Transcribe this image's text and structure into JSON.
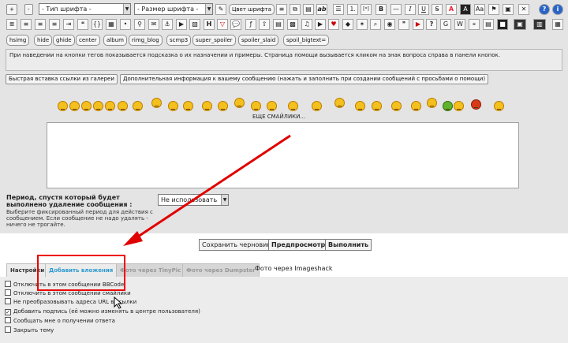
{
  "toolbar1": {
    "plus": "+",
    "minus": "-",
    "font_type": "- Тип шрифта -",
    "font_size": "- Размер шрифта -",
    "font_color_button": "Цвет шрифта",
    "glyph_labels": [
      "ab",
      "[*]",
      "B",
      "I",
      "U",
      "A",
      "A",
      "?"
    ]
  },
  "toolbar2": {
    "glyph_labels": [
      "H",
      "?"
    ]
  },
  "tag_buttons": [
    "hsimg",
    "hide",
    "ghide",
    "center",
    "album",
    "rimg_blog",
    "scmp3",
    "super_spoiler",
    "spoiler_slaid",
    "spoil_bigtext="
  ],
  "hint_text": "При наведении на кнопки тегов показывается подсказка о их назначении и примеры. Страница помощи вызывается кликом на знак вопроса справа в панели кнопок.",
  "gallery_link": "Быстрая вставка ссылки из галереи",
  "additional_info_link": "Дополнительная информация к вашему сообщению (нажать и заполнить при создании сообщений с просьбами о помощи)",
  "more_smilies": "ЕЩЕ СМАЙЛИКИ...",
  "auto_delete": {
    "label": "Период, спустя который будет выполнено удаление сообщения :",
    "description": "Выберите фиксированный период для действия с сообщением. Если сообщение не надо удалять - ничего не трогайте.",
    "value": "Не использовать"
  },
  "actions": {
    "save_draft": "Сохранить черновик",
    "preview": "Предпросмотр",
    "submit": "Выполнить"
  },
  "tabs": [
    "Настройки",
    "Добавить вложения",
    "Фото через TinyPic",
    "Фото через Dumpster",
    "Фото через Imageshack"
  ],
  "options": [
    {
      "label": "Отключить в этом сообщении BBCode",
      "checked": false
    },
    {
      "label": "Отключить в этом сообщении смайлики",
      "checked": false
    },
    {
      "label": "Не преобразовывать адреса URL в ссылки",
      "checked": false
    },
    {
      "label": "Добавить подпись (её можно изменять в центре пользователя)",
      "checked": true
    },
    {
      "label": "Сообщать мне о получении ответа",
      "checked": false
    },
    {
      "label": "Закрыть тему",
      "checked": false
    }
  ],
  "checkmark": "✓",
  "colors": {
    "accent_tab": "#2e9ad0",
    "annotation": "#e00000",
    "panel": "#e4e4e4"
  }
}
